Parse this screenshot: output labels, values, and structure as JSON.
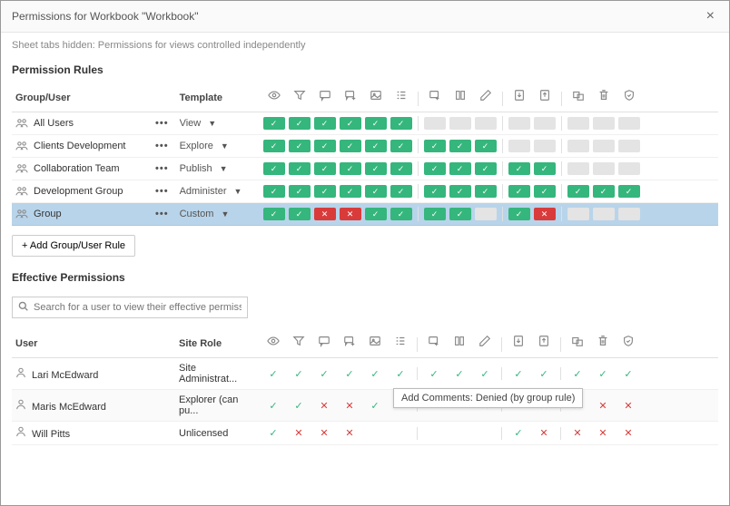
{
  "header": {
    "title": "Permissions for Workbook \"Workbook\""
  },
  "subtitle": "Sheet tabs hidden: Permissions for views controlled independently",
  "rules": {
    "title": "Permission Rules",
    "col_group": "Group/User",
    "col_template": "Template",
    "rows": [
      {
        "name": "All Users",
        "template": "View",
        "perms": [
          "a",
          "a",
          "a",
          "a",
          "a",
          "a",
          "|",
          "u",
          "u",
          "u",
          "|",
          "u",
          "u",
          "|",
          "u",
          "u",
          "u"
        ]
      },
      {
        "name": "Clients Development",
        "template": "Explore",
        "perms": [
          "a",
          "a",
          "a",
          "a",
          "a",
          "a",
          "|",
          "a",
          "a",
          "a",
          "|",
          "u",
          "u",
          "|",
          "u",
          "u",
          "u"
        ]
      },
      {
        "name": "Collaboration Team",
        "template": "Publish",
        "perms": [
          "a",
          "a",
          "a",
          "a",
          "a",
          "a",
          "|",
          "a",
          "a",
          "a",
          "|",
          "a",
          "a",
          "|",
          "u",
          "u",
          "u"
        ]
      },
      {
        "name": "Development Group",
        "template": "Administer",
        "perms": [
          "a",
          "a",
          "a",
          "a",
          "a",
          "a",
          "|",
          "a",
          "a",
          "a",
          "|",
          "a",
          "a",
          "|",
          "a",
          "a",
          "a"
        ]
      },
      {
        "name": "Group",
        "template": "Custom",
        "perms": [
          "a",
          "a",
          "d",
          "d",
          "a",
          "a",
          "|",
          "a",
          "a",
          "u",
          "|",
          "a",
          "d",
          "|",
          "u",
          "u",
          "u"
        ],
        "selected": true
      }
    ],
    "add_button": "+ Add Group/User Rule"
  },
  "effective": {
    "title": "Effective Permissions",
    "search_placeholder": "Search for a user to view their effective permissions",
    "col_user": "User",
    "col_role": "Site Role",
    "rows": [
      {
        "name": "Lari McEdward",
        "role": "Site Administrat...",
        "perms": [
          "a",
          "a",
          "a",
          "a",
          "a",
          "a",
          "|",
          "a",
          "a",
          "a",
          "|",
          "a",
          "a",
          "|",
          "a",
          "a",
          "a"
        ]
      },
      {
        "name": "Maris McEdward",
        "role": "Explorer (can pu...",
        "perms": [
          "a",
          "a",
          "d",
          "d",
          "a",
          "a",
          "|",
          "a",
          "a",
          "d",
          "|",
          "a",
          "d",
          "|",
          "d",
          "d",
          "d"
        ]
      },
      {
        "name": "Will Pitts",
        "role": "Unlicensed",
        "perms": [
          "a",
          "d",
          "d",
          "d",
          "",
          "",
          "|",
          "",
          "",
          "",
          "|",
          "a",
          "d",
          "|",
          "d",
          "d",
          "d"
        ]
      }
    ],
    "tooltip": "Add Comments: Denied (by group rule)"
  },
  "icons": {
    "heads": [
      "view",
      "filter",
      "comment",
      "add-comment",
      "image",
      "summary",
      "|",
      "web-edit",
      "share",
      "edit",
      "|",
      "download",
      "full-data",
      "|",
      "move",
      "delete",
      "set-perms"
    ]
  }
}
